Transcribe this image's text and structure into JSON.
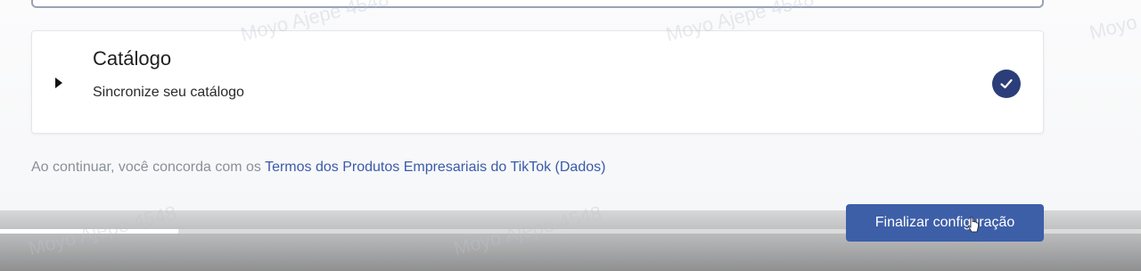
{
  "catalog_card": {
    "title": "Catálogo",
    "subtitle": "Sincronize seu catálogo",
    "completed_icon": "check-circle-icon",
    "expand_icon": "caret-right-icon"
  },
  "terms": {
    "prefix": "Ao continuar, você concorda com os ",
    "link_text": "Termos dos Produtos Empresariais do TikTok (Dados)"
  },
  "finish_button": {
    "label": "Finalizar configuração"
  },
  "video_player": {
    "progress": 0.156
  },
  "watermark": {
    "text": "Moyo Ajepe 4548",
    "text_short": "Moyo"
  },
  "colors": {
    "accent": "#3d5fa8",
    "check": "#2b3e7a",
    "link": "#3a5baa"
  }
}
